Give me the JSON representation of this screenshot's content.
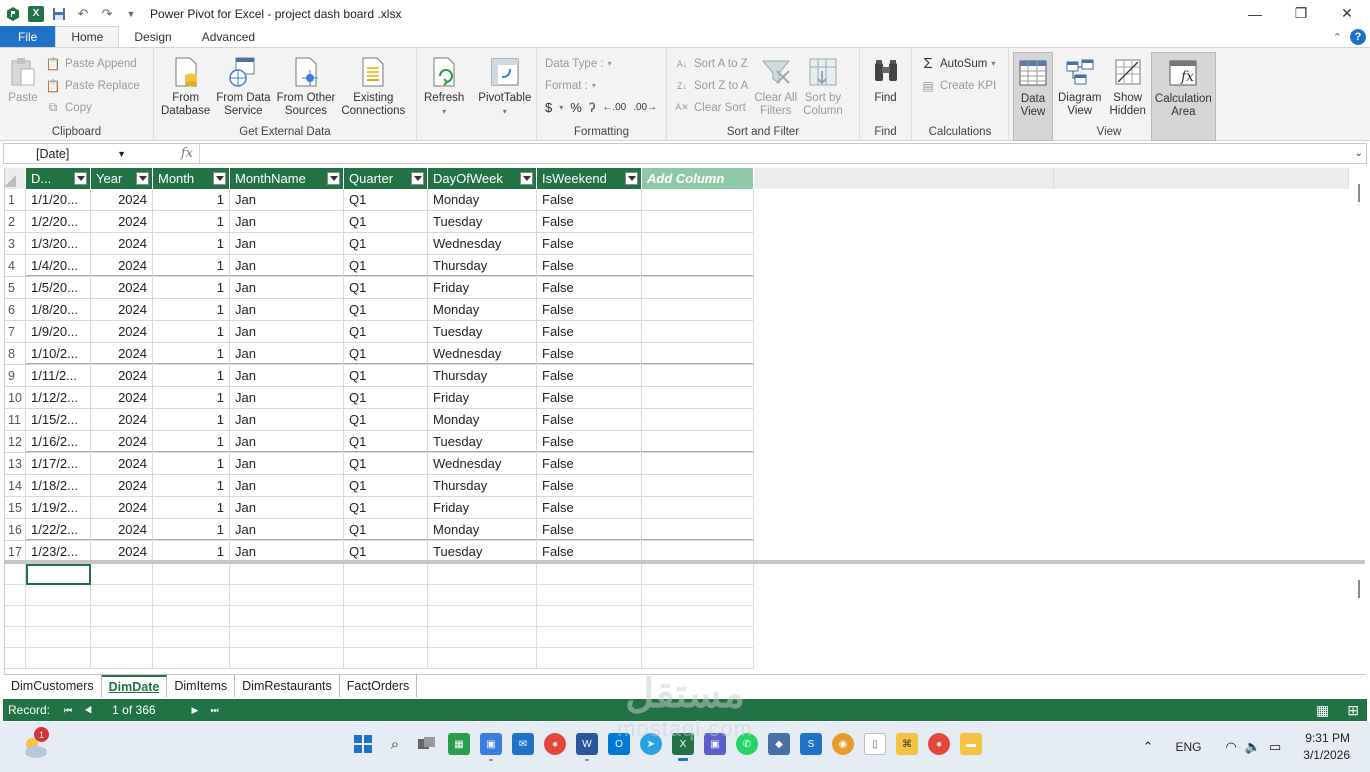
{
  "window": {
    "title": "Power Pivot for Excel - project dash board .xlsx",
    "controls": [
      "minimize",
      "restore",
      "close"
    ]
  },
  "tabs": [
    "File",
    "Home",
    "Design",
    "Advanced"
  ],
  "active_tab": "Home",
  "ribbon": {
    "clipboard": {
      "label": "Clipboard",
      "paste": "Paste",
      "paste_append": "Paste Append",
      "paste_replace": "Paste Replace",
      "copy": "Copy"
    },
    "external": {
      "label": "Get External Data",
      "from_database": [
        "From",
        "Database"
      ],
      "from_data_service": [
        "From Data",
        "Service"
      ],
      "from_other": [
        "From Other",
        "Sources"
      ],
      "existing": [
        "Existing",
        "Connections"
      ]
    },
    "refresh": {
      "label": "Refresh"
    },
    "pivot": {
      "label": "PivotTable"
    },
    "formatting": {
      "label": "Formatting",
      "data_type": "Data Type :",
      "format": "Format :",
      "symbols": [
        "$",
        "%",
        "ʔ",
        ".00",
        ".00"
      ]
    },
    "sortfilter": {
      "label": "Sort and Filter",
      "sort_az": "Sort A to Z",
      "sort_za": "Sort Z to A",
      "clear_sort": "Clear Sort",
      "clear_filters": [
        "Clear All",
        "Filters"
      ],
      "sort_by_col": [
        "Sort by",
        "Column"
      ]
    },
    "find": {
      "label": "Find",
      "button": "Find"
    },
    "calculations": {
      "label": "Calculations",
      "autosum": "AutoSum",
      "create_kpi": "Create KPI"
    },
    "view": {
      "label": "View",
      "data_view": [
        "Data",
        "View"
      ],
      "diagram_view": [
        "Diagram",
        "View"
      ],
      "show_hidden": [
        "Show",
        "Hidden"
      ],
      "calc_area": [
        "Calculation",
        "Area"
      ]
    }
  },
  "formula_bar": {
    "name_box": "[Date]",
    "fx": "fx",
    "formula": ""
  },
  "table": {
    "columns": [
      "D...",
      "Year",
      "Month",
      "MonthName",
      "Quarter",
      "DayOfWeek",
      "IsWeekend",
      "Add Column"
    ],
    "rows": [
      [
        "1",
        "1/1/20...",
        "2024",
        "1",
        "Jan",
        "Q1",
        "Monday",
        "False"
      ],
      [
        "2",
        "1/2/20...",
        "2024",
        "1",
        "Jan",
        "Q1",
        "Tuesday",
        "False"
      ],
      [
        "3",
        "1/3/20...",
        "2024",
        "1",
        "Jan",
        "Q1",
        "Wednesday",
        "False"
      ],
      [
        "4",
        "1/4/20...",
        "2024",
        "1",
        "Jan",
        "Q1",
        "Thursday",
        "False"
      ],
      [
        "5",
        "1/5/20...",
        "2024",
        "1",
        "Jan",
        "Q1",
        "Friday",
        "False"
      ],
      [
        "6",
        "1/8/20...",
        "2024",
        "1",
        "Jan",
        "Q1",
        "Monday",
        "False"
      ],
      [
        "7",
        "1/9/20...",
        "2024",
        "1",
        "Jan",
        "Q1",
        "Tuesday",
        "False"
      ],
      [
        "8",
        "1/10/2...",
        "2024",
        "1",
        "Jan",
        "Q1",
        "Wednesday",
        "False"
      ],
      [
        "9",
        "1/11/2...",
        "2024",
        "1",
        "Jan",
        "Q1",
        "Thursday",
        "False"
      ],
      [
        "10",
        "1/12/2...",
        "2024",
        "1",
        "Jan",
        "Q1",
        "Friday",
        "False"
      ],
      [
        "11",
        "1/15/2...",
        "2024",
        "1",
        "Jan",
        "Q1",
        "Monday",
        "False"
      ],
      [
        "12",
        "1/16/2...",
        "2024",
        "1",
        "Jan",
        "Q1",
        "Tuesday",
        "False"
      ],
      [
        "13",
        "1/17/2...",
        "2024",
        "1",
        "Jan",
        "Q1",
        "Wednesday",
        "False"
      ],
      [
        "14",
        "1/18/2...",
        "2024",
        "1",
        "Jan",
        "Q1",
        "Thursday",
        "False"
      ],
      [
        "15",
        "1/19/2...",
        "2024",
        "1",
        "Jan",
        "Q1",
        "Friday",
        "False"
      ],
      [
        "16",
        "1/22/2...",
        "2024",
        "1",
        "Jan",
        "Q1",
        "Monday",
        "False"
      ],
      [
        "17",
        "1/23/2...",
        "2024",
        "1",
        "Jan",
        "Q1",
        "Tuesday",
        "False"
      ]
    ]
  },
  "sheet_tabs": [
    "DimCustomers",
    "DimDate",
    "DimItems",
    "DimRestaurants",
    "FactOrders"
  ],
  "active_sheet": "DimDate",
  "status": {
    "record_label": "Record:",
    "position": "1 of 366"
  },
  "taskbar": {
    "weather_badge": "1",
    "language": "ENG",
    "time": "9:31 PM",
    "date": "3/1/2026"
  },
  "watermark": {
    "arabic": "مستقل",
    "latin": "mostaql.com"
  },
  "colors": {
    "excel_green": "#217346",
    "header_green": "#217346",
    "add_column_green": "#8ec8a6",
    "file_tab_blue": "#1e73c8",
    "ribbon_bg": "#f3f3f3"
  }
}
